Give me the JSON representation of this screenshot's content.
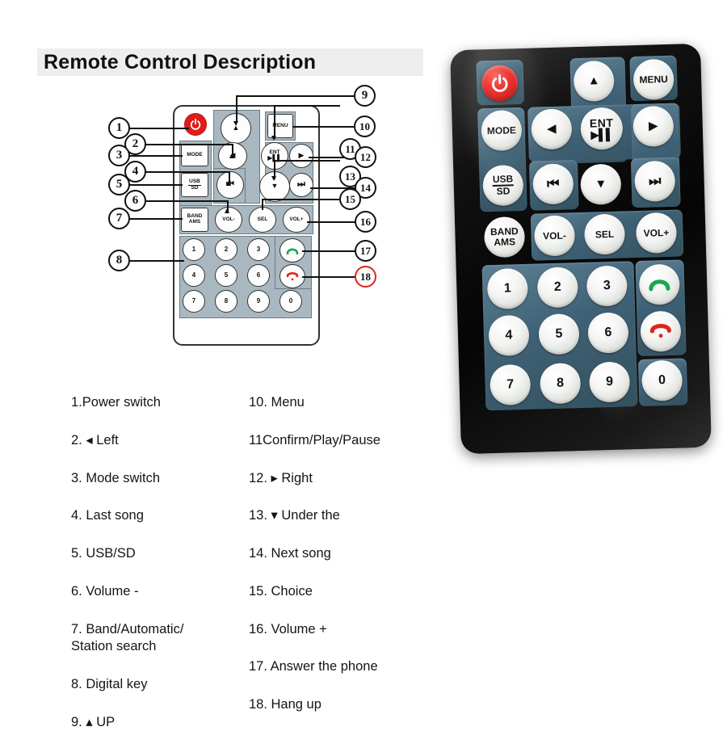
{
  "header": {
    "title": "Remote Control Description"
  },
  "colors": {
    "banner_bg": "#eeeeee",
    "power_red": "#e01b1b",
    "pad_diagram": "#a9b8c0",
    "pad_photo": "#3f6175",
    "callout_red": "#e2231a",
    "answer_green": "#17a84a",
    "hangup_red": "#e2231a"
  },
  "diagram": {
    "callouts": [
      {
        "id": "1",
        "label": "1"
      },
      {
        "id": "2",
        "label": "2"
      },
      {
        "id": "3",
        "label": "3"
      },
      {
        "id": "4",
        "label": "4"
      },
      {
        "id": "5",
        "label": "5"
      },
      {
        "id": "6",
        "label": "6"
      },
      {
        "id": "7",
        "label": "7"
      },
      {
        "id": "8",
        "label": "8"
      },
      {
        "id": "9",
        "label": "9"
      },
      {
        "id": "10",
        "label": "10"
      },
      {
        "id": "11",
        "label": "11"
      },
      {
        "id": "12",
        "label": "12"
      },
      {
        "id": "13",
        "label": "13"
      },
      {
        "id": "14",
        "label": "14"
      },
      {
        "id": "15",
        "label": "15"
      },
      {
        "id": "16",
        "label": "16"
      },
      {
        "id": "17",
        "label": "17"
      },
      {
        "id": "18",
        "label": "18"
      }
    ],
    "buttons": {
      "power": "",
      "up": "▲",
      "menu": "MENU",
      "mode": "MODE",
      "left": "◀",
      "ent_label": "ENT",
      "ent_symbol": "▶▐▐",
      "right": "▶",
      "usb_sd": "USB\nSD",
      "prev": "⏮",
      "down": "▼",
      "next": "⏭",
      "band_ams": "BAND\nAMS",
      "vol_down": "VOL-",
      "sel": "SEL",
      "vol_up": "VOL+",
      "keys": [
        "1",
        "2",
        "3",
        "4",
        "5",
        "6",
        "7",
        "8",
        "9",
        "0"
      ],
      "answer": "answer-call",
      "hangup": "hang-up-call"
    }
  },
  "photo": {
    "buttons": {
      "power": "",
      "up": "▲",
      "menu": "MENU",
      "mode": "MODE",
      "left": "◀",
      "ent_label": "ENT",
      "ent_symbol": "▶▐▐",
      "right": "▶",
      "usb": "USB",
      "sd": "SD",
      "prev": "⏮",
      "down": "▼",
      "next": "⏭",
      "band": "BAND",
      "ams": "AMS",
      "vol_down": "VOL-",
      "sel": "SEL",
      "vol_up": "VOL+",
      "keys": [
        "1",
        "2",
        "3",
        "4",
        "5",
        "6",
        "7",
        "8",
        "9",
        "0"
      ]
    }
  },
  "description": {
    "left_column": [
      "1.Power switch",
      "2. ◂  Left",
      "3. Mode switch",
      "4. Last song",
      "5. USB/SD",
      "6. Volume -",
      "7. Band/Automatic/\n    Station search",
      "8. Digital key",
      "9. ▴ UP"
    ],
    "right_column": [
      "10. Menu",
      "11Confirm/Play/Pause",
      "12. ▸ Right",
      "13. ▾  Under the",
      "14. Next song",
      "15. Choice",
      "16. Volume +",
      "17. Answer the phone",
      "18. Hang up"
    ]
  }
}
